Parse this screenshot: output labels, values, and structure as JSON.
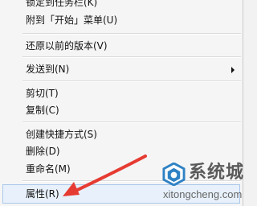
{
  "context_menu": {
    "items": [
      {
        "label": "锁定到任务栏(K)"
      },
      {
        "label": "附到「开始」菜单(U)"
      },
      {
        "label": "还原以前的版本(V)"
      },
      {
        "label": "发送到(N)"
      },
      {
        "label": "剪切(T)"
      },
      {
        "label": "复制(C)"
      },
      {
        "label": "创建快捷方式(S)"
      },
      {
        "label": "删除(D)"
      },
      {
        "label": "重命名(M)"
      },
      {
        "label": "属性(R)"
      }
    ],
    "selected_item": "属性(R)"
  },
  "annotation": {
    "arrow_color": "#e63b32"
  },
  "watermark": {
    "site_name": "系统城",
    "url": "xitongcheng.com",
    "logo_icon": "blue-hexagon-logo-icon"
  }
}
